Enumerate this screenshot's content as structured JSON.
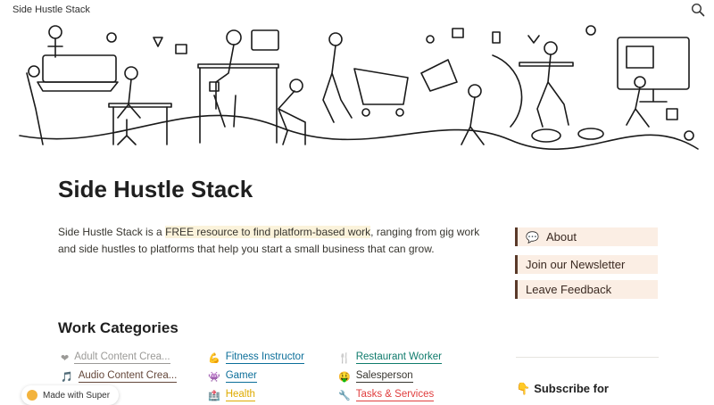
{
  "site": {
    "title": "Side Hustle Stack"
  },
  "page": {
    "title": "Side Hustle Stack"
  },
  "intro": {
    "prefix": "Side Hustle Stack is a ",
    "highlight": "FREE resource to find platform-based work",
    "suffix": ", ranging from gig work and side hustles to platforms that help you start a small business that can grow."
  },
  "sidebar": {
    "about": {
      "icon": "speech-bubble",
      "label": "About"
    },
    "newsletter": {
      "label": "Join our Newsletter"
    },
    "feedback": {
      "label": "Leave Feedback"
    },
    "subscribe": {
      "icon": "pointing-down",
      "label": "Subscribe for"
    }
  },
  "categories_heading": "Work Categories",
  "categories": [
    {
      "icon": "heart",
      "label": "Adult Content Crea...",
      "color": "#9b9a97"
    },
    {
      "icon": "musical-note",
      "label": "Audio Content Crea...",
      "color": "#64473a"
    },
    {
      "icon": "flexed-bicep",
      "label": "Fitness Instructor",
      "color": "#0b6e99"
    },
    {
      "icon": "space-invader",
      "label": "Gamer",
      "color": "#0b6e99"
    },
    {
      "icon": "hospital",
      "label": "Health",
      "color": "#dfab01"
    },
    {
      "icon": "fork-knife",
      "label": "Restaurant Worker",
      "color": "#0f7b6c"
    },
    {
      "icon": "money-mouth",
      "label": "Salesperson",
      "color": "#37352f"
    },
    {
      "icon": "wrench",
      "label": "Tasks & Services",
      "color": "#e03e3e"
    }
  ],
  "footer": {
    "made_with": "Made with Super"
  },
  "colors": {
    "accent_button_bg": "#fbeee4",
    "accent_button_border": "#5a3a2a",
    "highlight_bg": "#fbf3db"
  }
}
